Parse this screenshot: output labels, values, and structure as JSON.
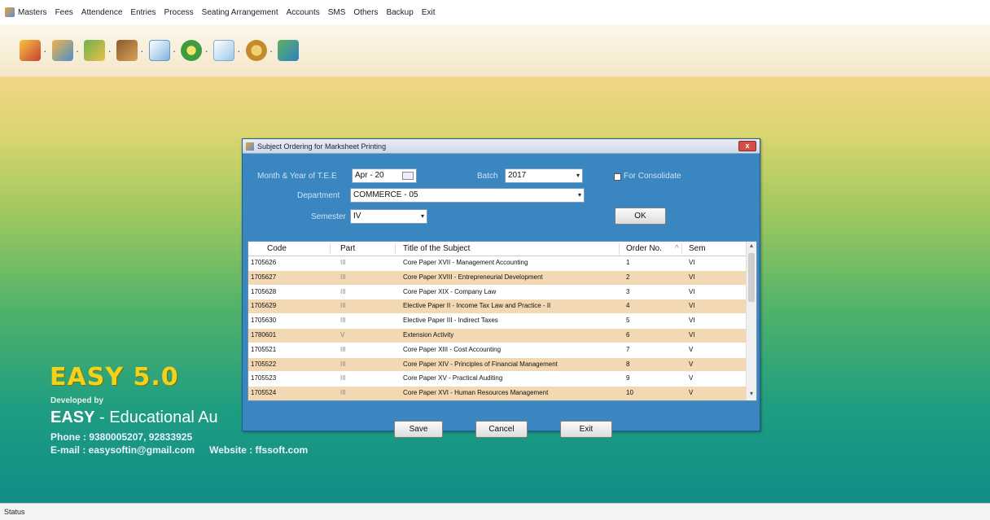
{
  "menu": [
    "Masters",
    "Fees",
    "Attendence",
    "Entries",
    "Process",
    "Seating Arrangement",
    "Accounts",
    "SMS",
    "Others",
    "Backup",
    "Exit"
  ],
  "toolbar": {
    "icons": [
      "gift-icon",
      "users-icon",
      "group-icon",
      "books-icon",
      "calendar-icon",
      "clock-icon",
      "notepad-icon",
      "settings-icon",
      "exit-icon"
    ],
    "dropdown_glyph": "·"
  },
  "brand": {
    "title": "EASY 5.0",
    "developed_by": "Developed by",
    "name_bold": "EASY",
    "name_rest": " - Educational Au",
    "phone": "Phone : 9380005207, 92833925",
    "email": "E-mail : easysoftin@gmail.com",
    "website": "Website : ffssoft.com"
  },
  "dialog": {
    "title": "Subject Ordering for Marksheet Printing",
    "close_label": "x",
    "labels": {
      "month_year": "Month & Year of T.E.E",
      "batch": "Batch",
      "department": "Department",
      "semester": "Semester",
      "for_consolidate": "For Consolidate"
    },
    "values": {
      "month_year": "Apr - 20",
      "batch": "2017",
      "department": "COMMERCE - 05",
      "semester": "IV"
    },
    "ok_label": "OK",
    "columns": [
      "Code",
      "Part",
      "Title of the Subject",
      "Order No.",
      "Sem"
    ],
    "rows": [
      {
        "code": "1705626",
        "part": "III",
        "title": "Core Paper XVII - Management Accounting",
        "order": "1",
        "sem": "VI"
      },
      {
        "code": "1705627",
        "part": "III",
        "title": "Core Paper XVIII - Entrepreneurial Development",
        "order": "2",
        "sem": "VI"
      },
      {
        "code": "1705628",
        "part": "III",
        "title": "Core Paper XIX - Company Law",
        "order": "3",
        "sem": "VI"
      },
      {
        "code": "1705629",
        "part": "III",
        "title": "Elective Paper II - Income Tax Law and Practice - II",
        "order": "4",
        "sem": "VI"
      },
      {
        "code": "1705630",
        "part": "III",
        "title": "Elective Paper III - Indirect Taxes",
        "order": "5",
        "sem": "VI"
      },
      {
        "code": "1780601",
        "part": "V",
        "title": "Extension Activity",
        "order": "6",
        "sem": "VI"
      },
      {
        "code": "1705521",
        "part": "III",
        "title": "Core Paper XIII - Cost Accounting",
        "order": "7",
        "sem": "V"
      },
      {
        "code": "1705522",
        "part": "III",
        "title": "Core Paper XIV - Principles of Financial Management",
        "order": "8",
        "sem": "V"
      },
      {
        "code": "1705523",
        "part": "III",
        "title": "Core Paper XV - Practical Auditing",
        "order": "9",
        "sem": "V"
      },
      {
        "code": "1705524",
        "part": "III",
        "title": "Core Paper XVI - Human Resources Management",
        "order": "10",
        "sem": "V"
      }
    ],
    "buttons": {
      "save": "Save",
      "cancel": "Cancel",
      "exit": "Exit"
    }
  },
  "status": "Status"
}
